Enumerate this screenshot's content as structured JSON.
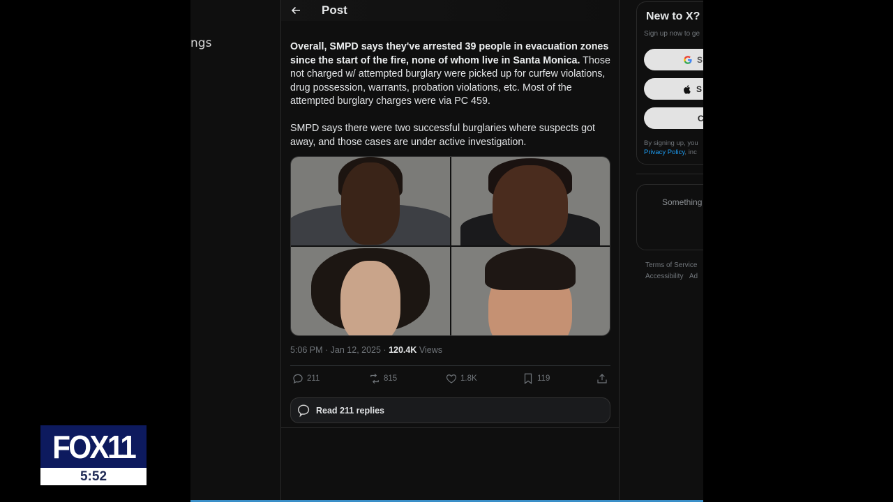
{
  "left_nav": {
    "partial_label": "ngs"
  },
  "header": {
    "title": "Post"
  },
  "tweet": {
    "paragraph1_bold": "Overall, SMPD says they've arrested 39 people in evacuation zones since the start of the fire, none of whom live in Santa Monica.",
    "paragraph1_rest": " Those not charged w/ attempted burglary were picked up for curfew violations, drug possession, warrants, probation violations, etc. Most of the attempted burglary charges were via PC 459.",
    "paragraph2": "SMPD says there were two successful burglaries where suspects got away, and those cases are under active investigation.",
    "media": [
      "mugshot-1",
      "mugshot-2",
      "mugshot-3",
      "mugshot-4"
    ],
    "timestamp": "5:06 PM · Jan 12, 2025 · ",
    "views_count": "120.4K",
    "views_label": " Views",
    "actions": {
      "replies": "211",
      "reposts": "815",
      "likes": "1.8K",
      "bookmarks": "119"
    },
    "read_replies_label": "Read 211 replies"
  },
  "sidebar": {
    "signup_title": "New to X?",
    "signup_sub": "Sign up now to ge",
    "google_button": "S",
    "apple_button": "S",
    "create_button": "C",
    "legal_line1": "By signing up, you",
    "legal_link": "Privacy Policy",
    "legal_line2_rest": ", inc",
    "trend_text": "Something",
    "footer_line1": "Terms of Service",
    "footer_line2a": "Accessibility",
    "footer_line2b": "Ad"
  },
  "overlay": {
    "network_logo": "FOX 11",
    "clock": "5:52"
  },
  "colors": {
    "background": "#0f0f0f",
    "link": "#1d9bf0",
    "fox_blue": "#0d1a5e"
  }
}
